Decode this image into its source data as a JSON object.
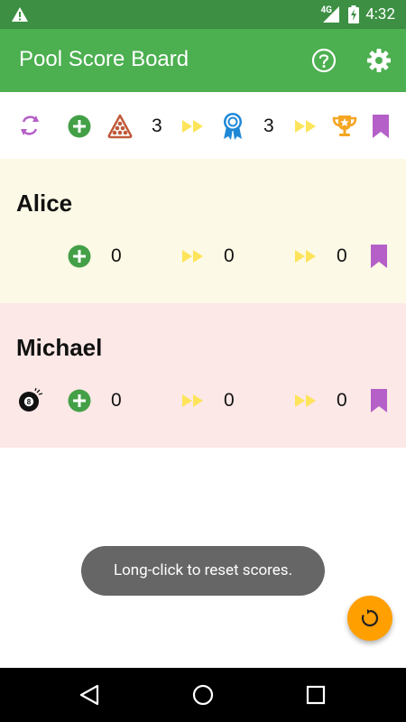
{
  "status_bar": {
    "network": "4G",
    "time": "4:32"
  },
  "app_bar": {
    "title": "Pool Score Board"
  },
  "toolbar": {
    "rack_count": "3",
    "award_count": "3"
  },
  "players": [
    {
      "name": "Alice",
      "score_a": "0",
      "score_b": "0",
      "score_c": "0"
    },
    {
      "name": "Michael",
      "score_a": "0",
      "score_b": "0",
      "score_c": "0"
    }
  ],
  "toast": {
    "message": "Long-click to reset scores."
  },
  "colors": {
    "status_bar": "#3c8f43",
    "app_bar": "#4caf50",
    "player1_bg": "#fcf9e6",
    "player2_bg": "#fce8e7",
    "fab": "#ff9f00",
    "accent_purple": "#b55fc8",
    "add_green": "#43a047",
    "arrow_yellow": "#fde45a"
  },
  "icons": {
    "status": [
      "warning-icon",
      "signal-icon",
      "battery-charging-icon"
    ],
    "app_bar": [
      "help-icon",
      "settings-icon"
    ],
    "toolbar": [
      "swap-players-icon",
      "add-icon",
      "rack-icon",
      "fast-forward-icon",
      "award-ribbon-icon",
      "fast-forward-icon",
      "trophy-icon",
      "bookmark-icon"
    ],
    "player": [
      "eight-ball-icon",
      "add-icon",
      "fast-forward-icon",
      "bookmark-icon"
    ],
    "fab": "reset-icon",
    "nav": [
      "back-icon",
      "home-icon",
      "recents-icon"
    ]
  }
}
